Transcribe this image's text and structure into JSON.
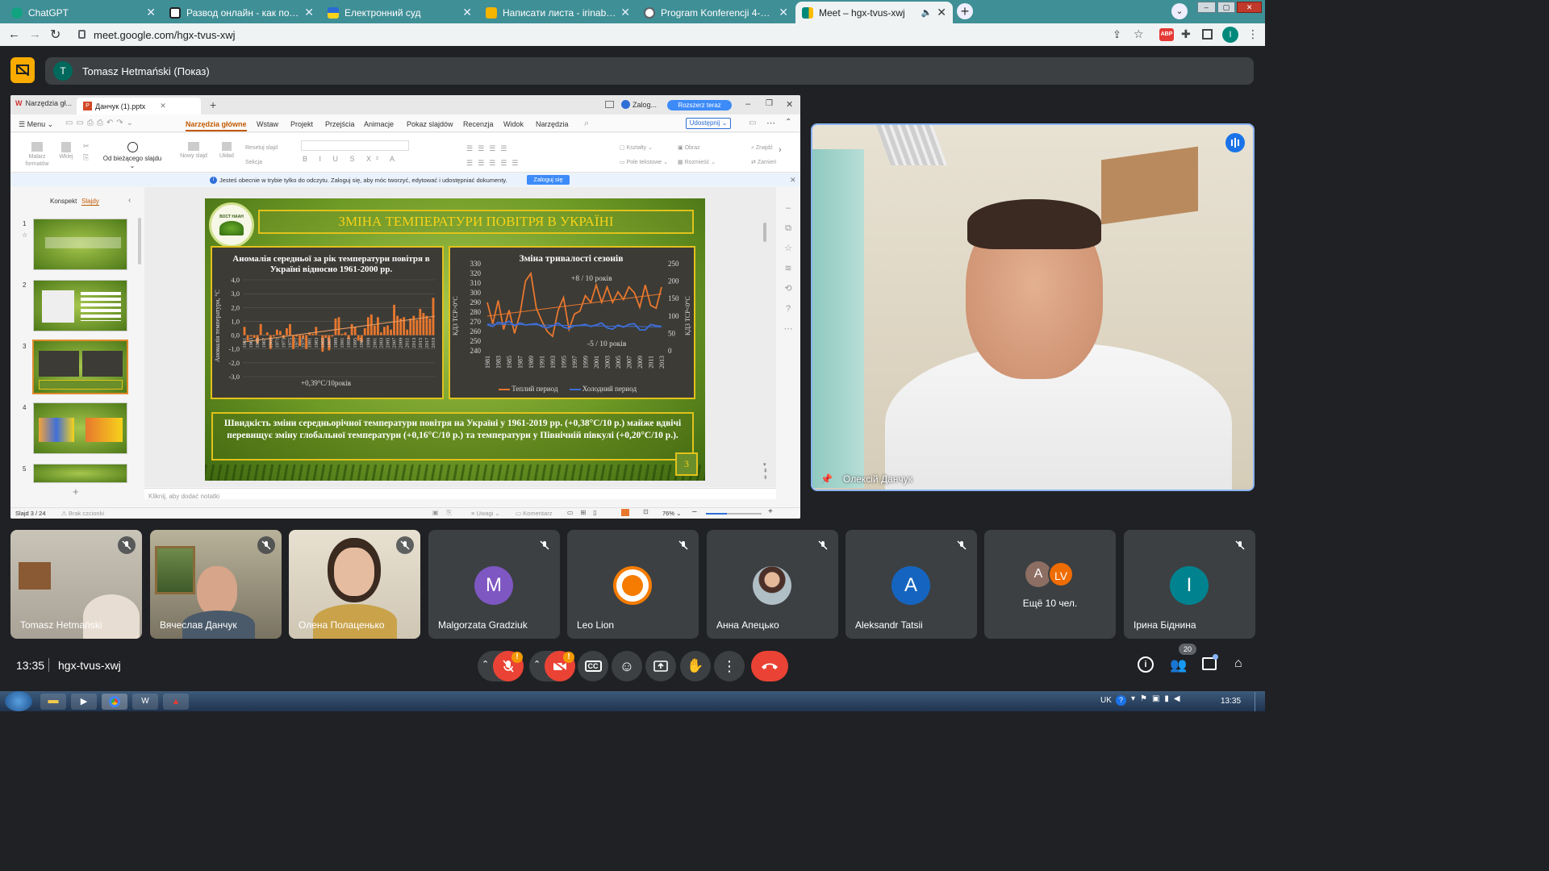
{
  "browser": {
    "tabs": [
      {
        "label": "ChatGPT",
        "color": "#10a37f"
      },
      {
        "label": "Развод онлайн - как подать зая",
        "color": "#202124"
      },
      {
        "label": "Електронний суд",
        "color": "#1a57c4"
      },
      {
        "label": "Написати листа - irinabidnina@",
        "color": "#f4b400"
      },
      {
        "label": "Program Konferencji 4-5 czerwca",
        "color": "#5f6368"
      },
      {
        "label": "Meet – hgx-tvus-xwj",
        "color": "#00897b"
      }
    ],
    "url": "meet.google.com/hgx-tvus-xwj",
    "profile_initial": "I"
  },
  "meet": {
    "presenter_initial": "T",
    "presenter_label": "Tomasz Hetmański (Показ)",
    "main_speaker_name": "Олексій Данчук",
    "time": "13:35",
    "meeting_code": "hgx-tvus-xwj",
    "participant_count": "20",
    "more_label": "Ещё 10 чел.",
    "tiles": [
      {
        "name": "Tomasz Hetmański",
        "type": "video"
      },
      {
        "name": "Вячеслав Данчук",
        "type": "video"
      },
      {
        "name": "Олена Полаценько",
        "type": "video"
      },
      {
        "name": "Malgorzata Gradziuk",
        "type": "initial",
        "initial": "M",
        "color": "#7e57c2"
      },
      {
        "name": "Leo Lion",
        "type": "image"
      },
      {
        "name": "Анна Апецько",
        "type": "image"
      },
      {
        "name": "Aleksandr Tatsii",
        "type": "initial",
        "initial": "A",
        "color": "#1565c0"
      },
      {
        "name": "",
        "type": "group"
      },
      {
        "name": "Ірина Біднина",
        "type": "initial",
        "initial": "I",
        "color": "#00838f"
      }
    ],
    "group_initials": [
      "A",
      "LV"
    ]
  },
  "present": {
    "tabs": [
      "Narzędzia gł...",
      "Данчук (1).pptx"
    ],
    "login_label": "Zalog...",
    "upgrade_label": "Rozszerz teraz",
    "menu_label": "Menu",
    "ribbon_tabs": [
      "Narzędzia główne",
      "Wstaw",
      "Projekt",
      "Przejścia",
      "Animacje",
      "Pokaz slajdów",
      "Recenzja",
      "Widok",
      "Narzędzia"
    ],
    "share_label": "Udostępnij",
    "ribbon_groups": {
      "painter": "Malarz formatów",
      "paste": "Wklej",
      "from_current": "Od bieżącego slajdu",
      "new_slide": "Nowy slajd",
      "layout": "Układ",
      "reset": "Resetuj slajd",
      "section": "Sekcja",
      "shapes": "Kształty",
      "image": "Obraz",
      "textbox": "Pole tekstowe",
      "arrange": "Rozmieść",
      "find": "Znajdź",
      "replace": "Zamień"
    },
    "info_text": "Jesteś obecnie w trybie tylko do odczytu. Zaloguj się, aby móc tworzyć, edytować i udostępniać dokumenty.",
    "info_button": "Zaloguj się",
    "pane_tabs": [
      "Konspekt",
      "Slajdy"
    ],
    "slide_numbers": [
      "1",
      "2",
      "3",
      "4",
      "5"
    ],
    "notes_placeholder": "Kliknij, aby dodać notatki",
    "status_slide": "Slajd 3 / 24",
    "status_font": "Brak czcionki",
    "status_notes": "Uwagi",
    "status_comment": "Komentarz",
    "zoom": "76%"
  },
  "slide": {
    "title": "ЗМІНА ТЕМПЕРАТУРИ ПОВІТРЯ В УКРАЇНІ",
    "logo_text": "ВОСТ НААН",
    "number": "3",
    "summary": "Швидкість  зміни  середньорічної температури повітря на Україні у 1961-2019 рр. (+0,38°С/10 р.) майже вдвічі перевищує  зміну глобальної температури (+0,16°С/10 р.)  та температури у Північній півкулі (+0,20°С/10 р.)."
  },
  "chart_data": [
    {
      "type": "bar",
      "title": "Аномалія середньої за рік температури повітря  в Україні відносно 1961-2000 рр.",
      "ylabel": "Аномалія температури, °С",
      "xlabel": "",
      "ylim": [
        -3.0,
        4.0
      ],
      "yticks": [
        "4,0",
        "3,0",
        "2,0",
        "1,0",
        "0,0",
        "-1,0",
        "-2,0",
        "-3,0"
      ],
      "x_tick_labels": [
        "1961",
        "1963",
        "1965",
        "1967",
        "1969",
        "1971",
        "1973",
        "1975",
        "1977",
        "1979",
        "1981",
        "1983",
        "1985",
        "1987",
        "1989",
        "1991",
        "1993",
        "1995",
        "1997",
        "1999",
        "2001",
        "2003",
        "2005",
        "2007",
        "2009",
        "2011",
        "2013",
        "2015",
        "2017",
        "2019"
      ],
      "x": [
        1961,
        1962,
        1963,
        1964,
        1965,
        1966,
        1967,
        1968,
        1969,
        1970,
        1971,
        1972,
        1973,
        1974,
        1975,
        1976,
        1977,
        1978,
        1979,
        1980,
        1981,
        1982,
        1983,
        1984,
        1985,
        1986,
        1987,
        1988,
        1989,
        1990,
        1991,
        1992,
        1993,
        1994,
        1995,
        1996,
        1997,
        1998,
        1999,
        2000,
        2001,
        2002,
        2003,
        2004,
        2005,
        2006,
        2007,
        2008,
        2009,
        2010,
        2011,
        2012,
        2013,
        2014,
        2015,
        2016,
        2017,
        2018,
        2019
      ],
      "values": [
        0.6,
        -0.4,
        -0.1,
        -0.2,
        -0.6,
        0.8,
        0.0,
        0.2,
        -1.0,
        -0.1,
        0.4,
        0.3,
        -0.2,
        0.5,
        0.8,
        -1.0,
        -0.1,
        -0.8,
        -0.2,
        -1.0,
        0.2,
        0.1,
        0.6,
        0.0,
        -1.2,
        -0.2,
        -1.1,
        -0.1,
        1.2,
        1.3,
        0.1,
        0.2,
        -0.3,
        0.8,
        0.6,
        -0.4,
        -0.5,
        0.5,
        1.3,
        1.5,
        0.7,
        1.3,
        0.2,
        0.6,
        0.7,
        0.4,
        2.2,
        1.4,
        1.2,
        1.3,
        0.4,
        1.2,
        1.4,
        1.1,
        1.9,
        1.6,
        1.4,
        1.2,
        2.7
      ],
      "annotation": "+0,39°С/10років",
      "series_color": "#e8772e"
    },
    {
      "type": "line",
      "title": "Зміна тривалості сезонів",
      "ylabel": "КДЗ ТСР>0°С",
      "y2label": "КДЗ ТСР<0°С",
      "ylim": [
        240,
        330
      ],
      "y2lim": [
        0,
        250
      ],
      "yticks": [
        "330",
        "320",
        "310",
        "300",
        "290",
        "280",
        "270",
        "260",
        "250",
        "240"
      ],
      "y2ticks": [
        "250",
        "200",
        "150",
        "100",
        "50",
        "0"
      ],
      "x_tick_labels": [
        "1981",
        "1983",
        "1985",
        "1987",
        "1989",
        "1991",
        "1993",
        "1995",
        "1997",
        "1999",
        "2001",
        "2003",
        "2005",
        "2007",
        "2009",
        "2011",
        "2013"
      ],
      "x": [
        1981,
        1982,
        1983,
        1984,
        1985,
        1986,
        1987,
        1988,
        1989,
        1990,
        1991,
        1992,
        1993,
        1994,
        1995,
        1996,
        1997,
        1998,
        1999,
        2000,
        2001,
        2002,
        2003,
        2004,
        2005,
        2006,
        2007,
        2008,
        2009,
        2010,
        2011,
        2012,
        2013
      ],
      "series": [
        {
          "name": "Теплий период",
          "axis": "left",
          "color": "#e8772e",
          "values": [
            290,
            268,
            292,
            262,
            282,
            258,
            278,
            312,
            320,
            284,
            271,
            260,
            255,
            282,
            295,
            262,
            278,
            281,
            297,
            290,
            308,
            290,
            306,
            290,
            301,
            293,
            306,
            300,
            285,
            308,
            287,
            284,
            306
          ]
        },
        {
          "name": "Холодний период",
          "axis": "right",
          "color": "#3f6fd8",
          "values": [
            75,
            70,
            82,
            78,
            85,
            72,
            80,
            74,
            76,
            78,
            70,
            66,
            72,
            80,
            68,
            64,
            72,
            73,
            76,
            70,
            74,
            80,
            66,
            62,
            74,
            68,
            76,
            78,
            60,
            60,
            76,
            72,
            70
          ]
        }
      ],
      "annotations": [
        "+8  / 10 років",
        "-5  / 10 років"
      ],
      "legend": "bottom"
    }
  ]
}
